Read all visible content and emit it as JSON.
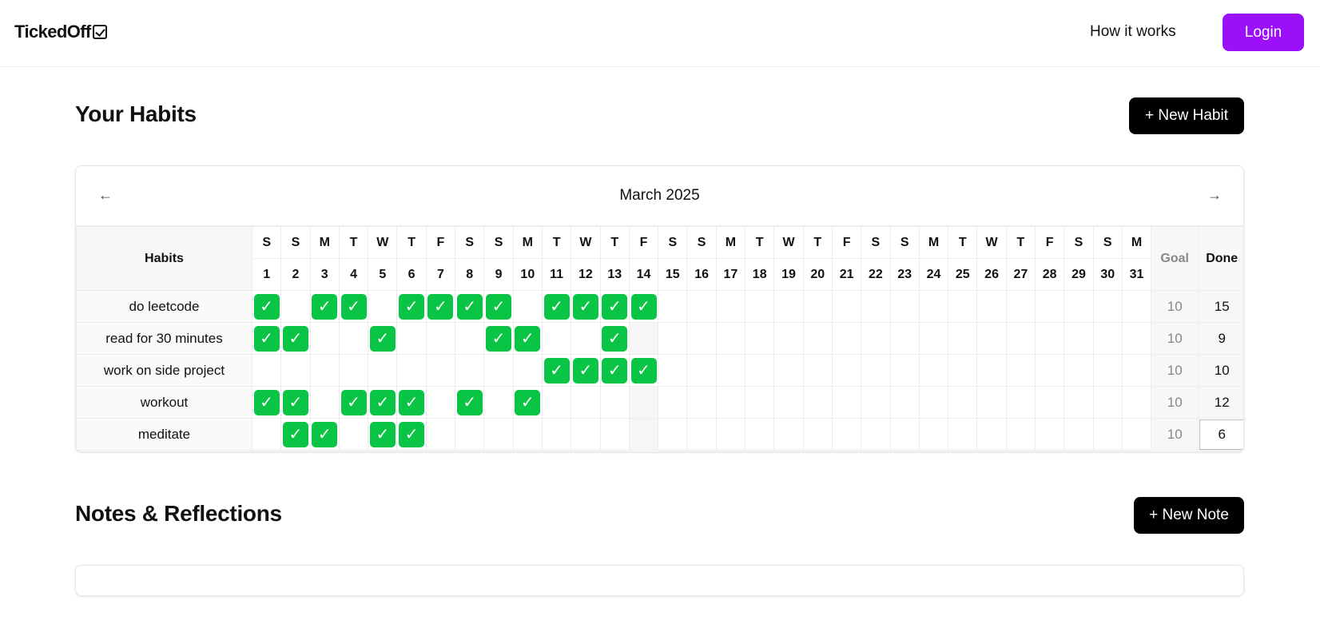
{
  "nav": {
    "logo": "TickedOff",
    "how_it_works": "How it works",
    "login": "Login"
  },
  "habits_section": {
    "title": "Your Habits",
    "new_button": "+ New Habit"
  },
  "calendar": {
    "prev_icon": "←",
    "next_icon": "→",
    "month": "March 2025",
    "habits_header": "Habits",
    "goal_header": "Goal",
    "done_header": "Done",
    "weekdays": [
      "S",
      "S",
      "M",
      "T",
      "W",
      "T",
      "F",
      "S",
      "S",
      "M",
      "T",
      "W",
      "T",
      "F",
      "S",
      "S",
      "M",
      "T",
      "W",
      "T",
      "F",
      "S",
      "S",
      "M",
      "T",
      "W",
      "T",
      "F",
      "S",
      "S",
      "M"
    ],
    "dates": [
      "1",
      "2",
      "3",
      "4",
      "5",
      "6",
      "7",
      "8",
      "9",
      "10",
      "11",
      "12",
      "13",
      "14",
      "15",
      "16",
      "17",
      "18",
      "19",
      "20",
      "21",
      "22",
      "23",
      "24",
      "25",
      "26",
      "27",
      "28",
      "29",
      "30",
      "31"
    ],
    "check_glyph": "✓",
    "check_color": "#0ac545",
    "rows": [
      {
        "name": "do leetcode",
        "checked": [
          1,
          3,
          4,
          6,
          7,
          8,
          9,
          11,
          12,
          13,
          14
        ],
        "goal": "10",
        "done": "15"
      },
      {
        "name": "read for 30 minutes",
        "checked": [
          1,
          2,
          5,
          9,
          10,
          13
        ],
        "goal": "10",
        "done": "9"
      },
      {
        "name": "work on side project",
        "checked": [
          11,
          12,
          13,
          14
        ],
        "goal": "10",
        "done": "10"
      },
      {
        "name": "workout",
        "checked": [
          1,
          2,
          4,
          5,
          6,
          8,
          10
        ],
        "goal": "10",
        "done": "12"
      },
      {
        "name": "meditate",
        "checked": [
          2,
          3,
          5,
          6
        ],
        "goal": "10",
        "done": "6"
      }
    ]
  },
  "notes_section": {
    "title": "Notes & Reflections",
    "new_button": "+ New Note"
  }
}
